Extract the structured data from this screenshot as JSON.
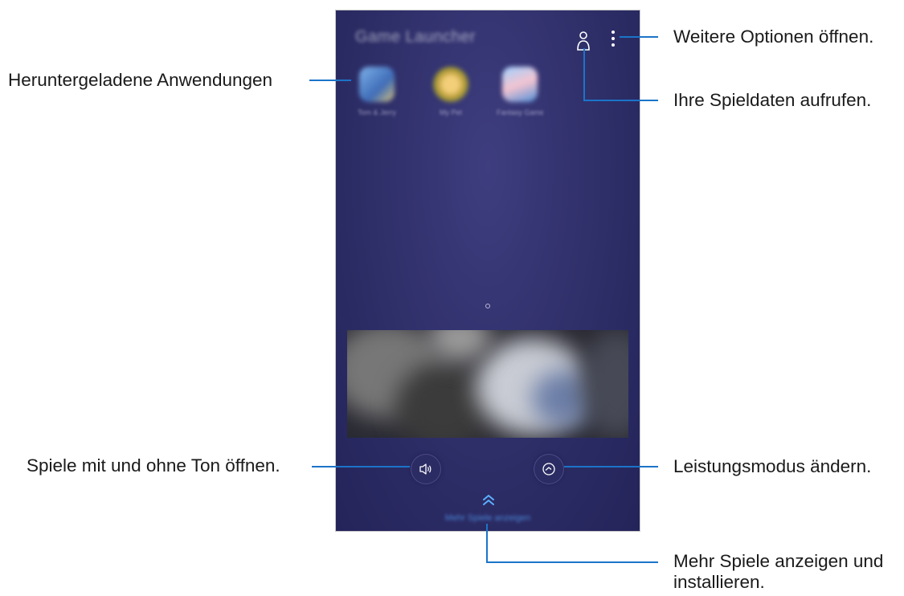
{
  "screen": {
    "app_title": "Game Launcher",
    "apps": [
      {
        "label": "Tom & Jerry",
        "icon": "app-icon-1",
        "color": "#4a86c8"
      },
      {
        "label": "My Pet",
        "icon": "app-icon-2",
        "color": "#c9b447"
      },
      {
        "label": "Fantasy Game",
        "icon": "app-icon-3",
        "color": "#5c9fe0"
      }
    ],
    "more_games_label": "Mehr Spiele anzeigen",
    "icons": {
      "profile": "profile-icon",
      "more": "more-options-icon",
      "sound": "speaker-icon",
      "performance": "performance-icon",
      "expand": "double-chevron-up-icon"
    },
    "colors": {
      "screen_bg": "#2e2e68",
      "callout_line": "#1b74c9",
      "accent": "#55a9ff"
    }
  },
  "callouts": {
    "downloaded_apps": "Heruntergeladene Anwendungen",
    "more_options": "Weitere Optionen öffnen.",
    "game_data": "Ihre Spieldaten aufrufen.",
    "sound": "Spiele mit und ohne Ton öffnen.",
    "performance": "Leistungsmodus ändern.",
    "more_games_line1": "Mehr Spiele anzeigen und",
    "more_games_line2": "installieren."
  }
}
